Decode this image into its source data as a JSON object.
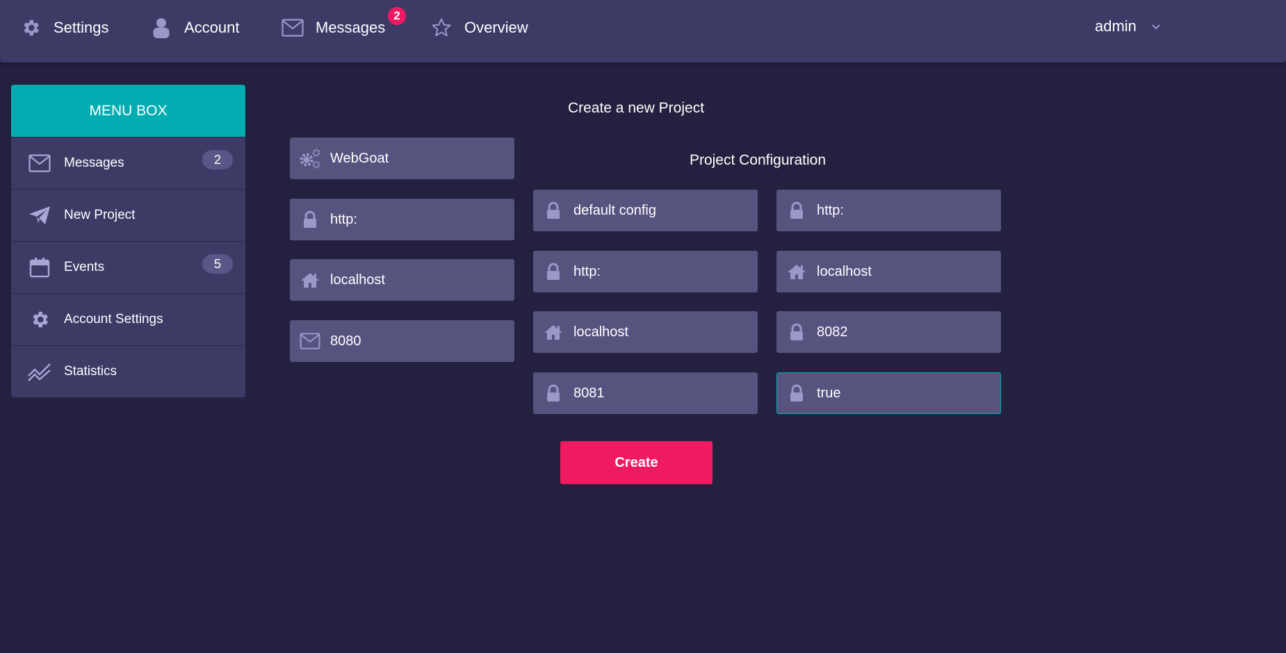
{
  "topnav": {
    "items": [
      {
        "label": "Settings",
        "icon": "gear-icon"
      },
      {
        "label": "Account",
        "icon": "user-icon"
      },
      {
        "label": "Messages",
        "icon": "envelope-icon",
        "badge": "2"
      },
      {
        "label": "Overview",
        "icon": "star-icon"
      }
    ],
    "user": "admin"
  },
  "menubox": {
    "title": "MENU BOX",
    "items": [
      {
        "label": "Messages",
        "icon": "envelope-icon",
        "count": "2"
      },
      {
        "label": "New Project",
        "icon": "paper-plane-icon"
      },
      {
        "label": "Events",
        "icon": "calendar-icon",
        "count": "5"
      },
      {
        "label": "Account Settings",
        "icon": "gear-icon"
      },
      {
        "label": "Statistics",
        "icon": "line-chart-icon"
      }
    ]
  },
  "form": {
    "title": "Create a new Project",
    "config_title": "Project Configuration",
    "left_fields": [
      {
        "value": "WebGoat",
        "icon": "gears-icon"
      },
      {
        "value": "http:",
        "icon": "lock-icon"
      },
      {
        "value": "localhost",
        "icon": "home-icon"
      },
      {
        "value": "8080",
        "icon": "envelope-icon"
      }
    ],
    "config_fields": [
      {
        "value": "default config",
        "icon": "lock-icon"
      },
      {
        "value": "http:",
        "icon": "lock-icon"
      },
      {
        "value": "http:",
        "icon": "lock-icon"
      },
      {
        "value": "localhost",
        "icon": "home-icon"
      },
      {
        "value": "localhost",
        "icon": "home-icon"
      },
      {
        "value": "8082",
        "icon": "lock-icon"
      },
      {
        "value": "8081",
        "icon": "lock-icon"
      },
      {
        "value": "true",
        "icon": "lock-icon"
      }
    ],
    "create_label": "Create"
  },
  "colors": {
    "background": "#23213f",
    "panel": "#3d3a66",
    "field": "#57537f",
    "accent": "#02adb1",
    "primary": "#ef1a60"
  }
}
